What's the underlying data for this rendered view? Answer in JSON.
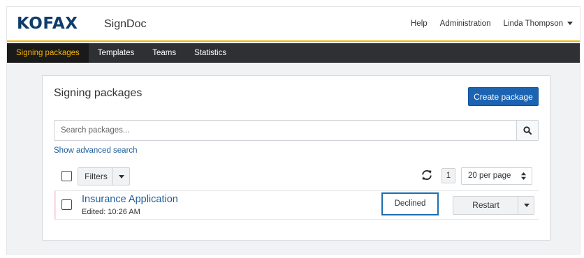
{
  "header": {
    "logo": "KOFAX",
    "app_name": "SignDoc",
    "links": {
      "help": "Help",
      "administration": "Administration",
      "user": "Linda Thompson"
    },
    "brand_color": "#0e3c6b",
    "accent_color": "#f5b400"
  },
  "nav": {
    "items": [
      {
        "label": "Signing packages",
        "active": true
      },
      {
        "label": "Templates",
        "active": false
      },
      {
        "label": "Teams",
        "active": false
      },
      {
        "label": "Statistics",
        "active": false
      }
    ]
  },
  "main": {
    "title": "Signing packages",
    "create_button": "Create package",
    "search": {
      "placeholder": "Search packages...",
      "value": "",
      "icon": "search-icon"
    },
    "advanced_search": "Show advanced search",
    "toolbar": {
      "filters": "Filters",
      "refresh_icon": "refresh-icon",
      "page": "1",
      "per_page": "20 per page"
    },
    "packages": [
      {
        "title": "Insurance Application",
        "edited": "Edited: 10:26 AM",
        "status": "Declined",
        "action": "Restart"
      }
    ],
    "primary_color": "#1c63b2"
  }
}
